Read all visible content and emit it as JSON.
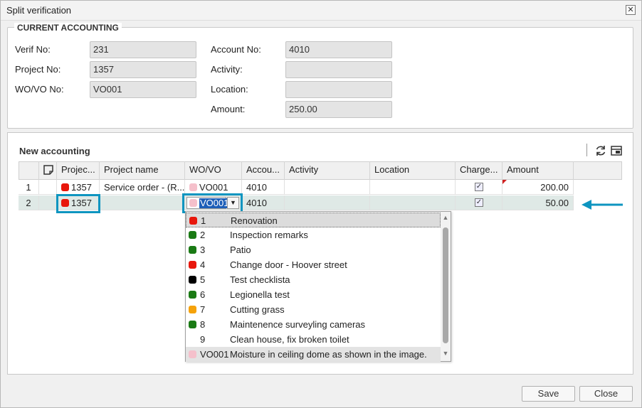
{
  "window": {
    "title": "Split verification"
  },
  "current": {
    "legend": "CURRENT ACCOUNTING",
    "verif_label": "Verif No:",
    "verif_value": "231",
    "project_label": "Project No:",
    "project_value": "1357",
    "wovo_label": "WO/VO No:",
    "wovo_value": "VO001",
    "account_label": "Account No:",
    "account_value": "4010",
    "activity_label": "Activity:",
    "activity_value": "",
    "location_label": "Location:",
    "location_value": "",
    "amount_label": "Amount:",
    "amount_value": "250.00"
  },
  "new_accounting": {
    "title": "New accounting",
    "toolbar": {
      "refresh_icon": "refresh-icon",
      "layout_icon": "grid-settings-icon"
    },
    "columns": [
      "Projec...",
      "Project name",
      "WO/VO",
      "Accou...",
      "Activity",
      "Location",
      "Charge...",
      "Amount"
    ],
    "rows": [
      {
        "num": "1",
        "project": "1357",
        "project_color": "#e8170c",
        "project_name": "Service order - (R...",
        "wovo": "VO001",
        "wovo_color": "#f5c0cb",
        "account": "4010",
        "activity": "",
        "location": "",
        "charge": "✓",
        "amount": "200.00"
      },
      {
        "num": "2",
        "project": "1357",
        "project_color": "#e8170c",
        "project_name": "",
        "wovo": "VO001",
        "wovo_color": "#f5c0cb",
        "account": "4010",
        "activity": "",
        "location": "",
        "charge": "✓",
        "amount": "50.00"
      }
    ]
  },
  "dropdown": {
    "options": [
      {
        "num": "1",
        "name": "Renovation",
        "color": "#e8170c"
      },
      {
        "num": "2",
        "name": "Inspection remarks",
        "color": "#1a7a14"
      },
      {
        "num": "3",
        "name": "Patio",
        "color": "#1a7a14"
      },
      {
        "num": "4",
        "name": "Change door - Hoover street",
        "color": "#e8170c"
      },
      {
        "num": "5",
        "name": "Test checklista",
        "color": "#000000"
      },
      {
        "num": "6",
        "name": "Legionella test",
        "color": "#1a7a14"
      },
      {
        "num": "7",
        "name": "Cutting grass",
        "color": "#f5a20a"
      },
      {
        "num": "8",
        "name": "Maintenence surveyling cameras",
        "color": "#1a7a14"
      },
      {
        "num": "9",
        "name": "Clean house, fix broken toilet",
        "color": ""
      },
      {
        "num": "VO001",
        "name": "Moisture in ceiling dome as shown in the image.",
        "color": "#f5c0cb"
      }
    ]
  },
  "buttons": {
    "save": "Save",
    "close": "Close"
  },
  "colors": {
    "highlight": "#0e95c0",
    "row_selected": "#dfe9e6"
  }
}
